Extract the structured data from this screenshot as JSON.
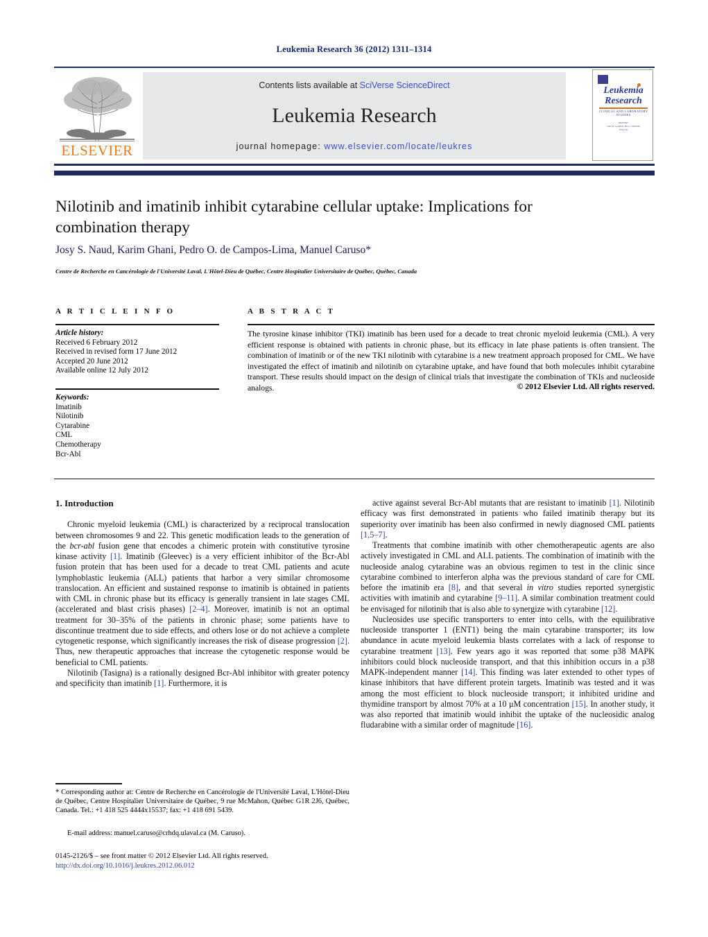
{
  "running_head": "Leukemia Research 36 (2012) 1311–1314",
  "masthead": {
    "contents_prefix": "Contents lists available at ",
    "contents_link": "SciVerse ScienceDirect",
    "journal_name": "Leukemia Research",
    "homepage_prefix": "journal homepage: ",
    "homepage_link": "www.elsevier.com/locate/leukres",
    "publisher_wordmark": "ELSEVIER",
    "cover": {
      "title_line1": "Leukemia",
      "title_line2": "Research",
      "subtitle": "CLINICAL AND LABORATORY STUDIES",
      "meta_line1": "EDITORS",
      "meta_line2": "John M. Goldman     Terry J. Hamblin",
      "meta_line3": "USA                          UK"
    }
  },
  "article": {
    "title": "Nilotinib and imatinib inhibit cytarabine cellular uptake: Implications for combination therapy",
    "authors": "Josy S. Naud, Karim Ghani, Pedro O. de Campos-Lima, Manuel Caruso",
    "corresponding_marker": "*",
    "affiliation": "Centre de Recherche en Cancérologie de l'Université Laval, L'Hôtel-Dieu de Québec, Centre Hospitalier Universitaire de Québec, Québec, Canada"
  },
  "article_info": {
    "heading": "A R T I C L E   I N F O",
    "history_label": "Article history:",
    "history": [
      "Received 6 February 2012",
      "Received in revised form 17 June 2012",
      "Accepted 20 June 2012",
      "Available online 12 July 2012"
    ],
    "keywords_label": "Keywords:",
    "keywords": [
      "Imatinib",
      "Nilotinib",
      "Cytarabine",
      "CML",
      "Chemotherapy",
      "Bcr-Abl"
    ]
  },
  "abstract": {
    "heading": "A B S T R A C T",
    "text": "The tyrosine kinase inhibitor (TKI) imatinib has been used for a decade to treat chronic myeloid leukemia (CML). A very efficient response is obtained with patients in chronic phase, but its efficacy in late phase patients is often transient. The combination of imatinib or of the new TKI nilotinib with cytarabine is a new treatment approach proposed for CML. We have investigated the effect of imatinib and nilotinib on cytarabine uptake, and have found that both molecules inhibit cytarabine transport. These results should impact on the design of clinical trials that investigate the combination of TKIs and nucleoside analogs.",
    "copyright": "© 2012 Elsevier Ltd. All rights reserved."
  },
  "body": {
    "section_heading": "1.  Introduction",
    "left_paragraphs": [
      "Chronic myeloid leukemia (CML) is characterized by a reciprocal translocation between chromosomes 9 and 22. This genetic modification leads to the generation of the bcr-abl fusion gene that encodes a chimeric protein with constitutive tyrosine kinase activity [1]. Imatinib (Gleevec) is a very efficient inhibitor of the Bcr-Abl fusion protein that has been used for a decade to treat CML patients and acute lymphoblastic leukemia (ALL) patients that harbor a very similar chromosome translocation. An efficient and sustained response to imatinib is obtained in patients with CML in chronic phase but its efficacy is generally transient in late stages CML (accelerated and blast crisis phases) [2–4]. Moreover, imatinib is not an optimal treatment for 30–35% of the patients in chronic phase; some patients have to discontinue treatment due to side effects, and others lose or do not achieve a complete cytogenetic response, which significantly increases the risk of disease progression [2]. Thus, new therapeutic approaches that increase the cytogenetic response would be beneficial to CML patients.",
      "Nilotinib (Tasigna) is a rationally designed Bcr-Abl inhibitor with greater potency and specificity than imatinib [1]. Furthermore, it is"
    ],
    "right_paragraphs": [
      "active against several Bcr-Abl mutants that are resistant to imatinib [1]. Nilotinib efficacy was first demonstrated in patients who failed imatinib therapy but its superiority over imatinib has been also confirmed in newly diagnosed CML patients [1,5–7].",
      "Treatments that combine imatinib with other chemotherapeutic agents are also actively investigated in CML and ALL patients. The combination of imatinib with the nucleoside analog cytarabine was an obvious regimen to test in the clinic since cytarabine combined to interferon alpha was the previous standard of care for CML before the imatinib era [8], and that several in vitro studies reported synergistic activities with imatinib and cytarabine [9–11]. A similar combination treatment could be envisaged for nilotinib that is also able to synergize with cytarabine [12].",
      "Nucleosides use specific transporters to enter into cells, with the equilibrative nucleoside transporter 1 (ENT1) being the main cytarabine transporter; its low abundance in acute myeloid leukemia blasts correlates with a lack of response to cytarabine treatment [13]. Few years ago it was reported that some p38 MAPK inhibitors could block nucleoside transport, and that this inhibition occurs in a p38 MAPK-independent manner [14]. This finding was later extended to other types of kinase inhibitors that have different protein targets. Imatinib was tested and it was among the most efficient to block nucleoside transport; it inhibited uridine and thymidine transport by almost 70% at a 10 μM concentration [15]. In another study, it was also reported that imatinib would inhibit the uptake of the nucleosidic analog fludarabine with a similar order of magnitude [16]."
    ]
  },
  "footnote": {
    "marker": "*",
    "text": " Corresponding author at: Centre de Recherche en Cancérologie de l'Université Laval, L'Hôtel-Dieu de Québec, Centre Hospitalier Universitaire de Québec, 9 rue McMahon, Québec G1R 2J6, Québec, Canada. Tel.: +1 418 525 4444x15537; fax: +1 418 691 5439.",
    "email_label": "E-mail address:",
    "email": "manuel.caruso@crhdq.ulaval.ca",
    "email_suffix": " (M. Caruso)."
  },
  "imprint": {
    "line1": "0145-2126/$ – see front matter © 2012 Elsevier Ltd. All rights reserved.",
    "doi": "http://dx.doi.org/10.1016/j.leukres.2012.06.012"
  }
}
